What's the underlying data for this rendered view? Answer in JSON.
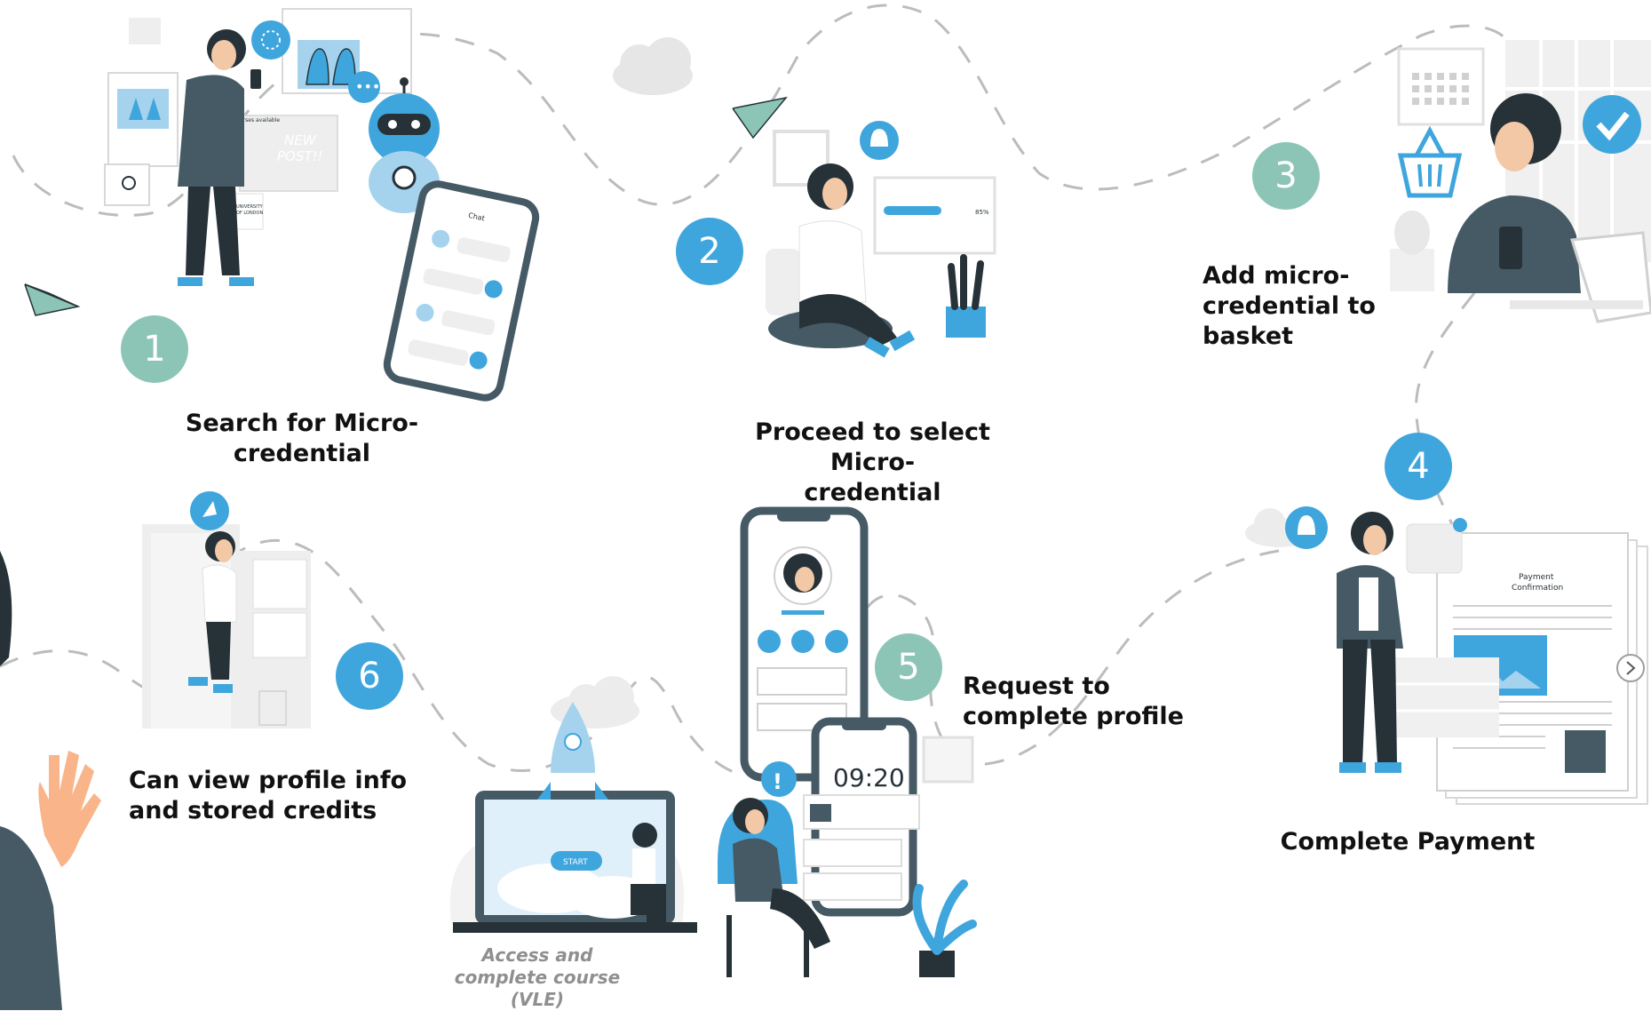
{
  "steps": [
    {
      "number": "1",
      "label": "Search for Micro-\ncredential"
    },
    {
      "number": "2",
      "label": "Proceed to select Micro-\ncredential"
    },
    {
      "number": "3",
      "label": "Add micro-\ncredential to basket"
    },
    {
      "number": "4",
      "label": "Complete Payment"
    },
    {
      "number": "5",
      "label": "Request to\ncomplete profile"
    },
    {
      "number": "6",
      "label": "Can view profile info\nand stored credits"
    }
  ],
  "vle_label": "Access and\ncomplete course\n(VLE)",
  "illustration_text": {
    "new_post": "NEW\nPOST!!",
    "course_available": "Courses available",
    "university": "UNIVERSITY\nOF LONDON",
    "chat": "Chat",
    "progress": "85%",
    "payment_confirmation": "Payment\nConfirmation",
    "clock": "09:20",
    "start": "START",
    "alert": "!"
  },
  "colors": {
    "accent_blue": "#3fa6dd",
    "accent_green": "#8cc5b6",
    "dark_navy": "#263238",
    "path_gray": "#b8b8b8"
  }
}
